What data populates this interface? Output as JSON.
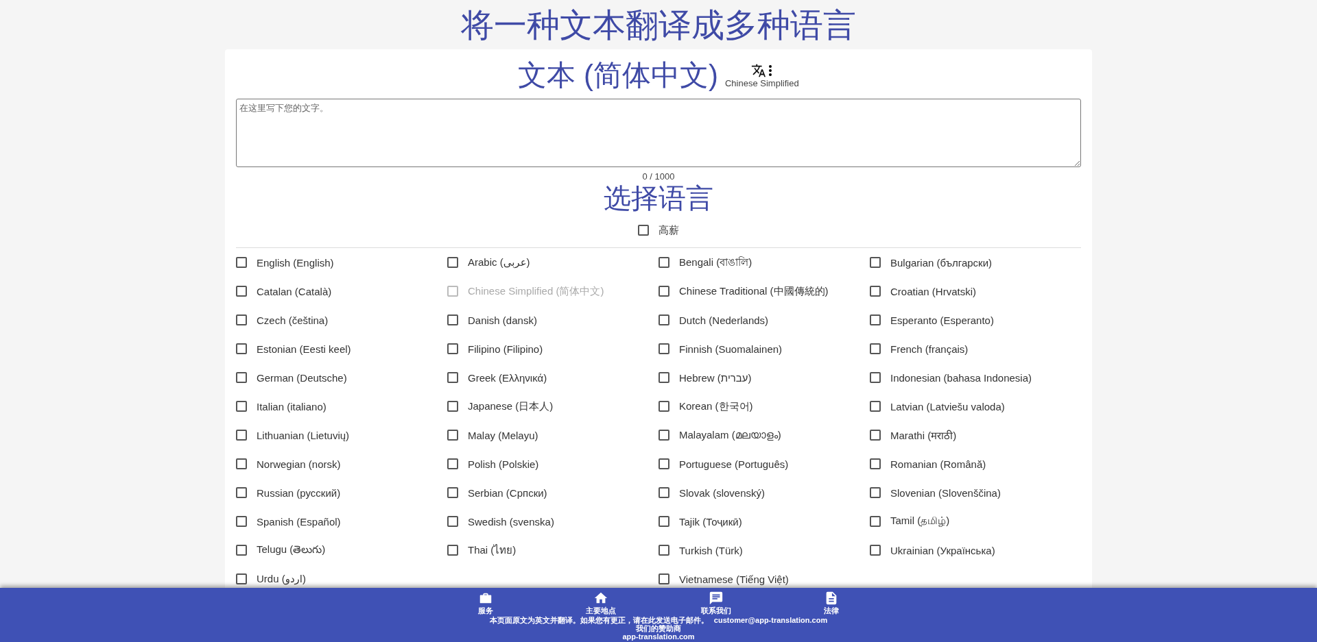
{
  "page_title": "将一种文本翻译成多种语言",
  "source": {
    "title": "文本 (简体中文)",
    "language_label": "Chinese Simplified",
    "placeholder": "在这里写下您的文字。",
    "counter": "0 / 1000"
  },
  "target": {
    "title": "选择语言",
    "select_all": {
      "label": "高薪",
      "checked": false
    },
    "languages": [
      {
        "label": "English (English)",
        "checked": false,
        "disabled": false
      },
      {
        "label": "Arabic (عربى)",
        "checked": false,
        "disabled": false
      },
      {
        "label": "Bengali (বাঙালি)",
        "checked": false,
        "disabled": false
      },
      {
        "label": "Bulgarian (български)",
        "checked": false,
        "disabled": false
      },
      {
        "label": "Catalan (Català)",
        "checked": false,
        "disabled": false
      },
      {
        "label": "Chinese Simplified (简体中文)",
        "checked": false,
        "disabled": true
      },
      {
        "label": "Chinese Traditional (中國傳統的)",
        "checked": false,
        "disabled": false
      },
      {
        "label": "Croatian (Hrvatski)",
        "checked": false,
        "disabled": false
      },
      {
        "label": "Czech (čeština)",
        "checked": false,
        "disabled": false
      },
      {
        "label": "Danish (dansk)",
        "checked": false,
        "disabled": false
      },
      {
        "label": "Dutch (Nederlands)",
        "checked": false,
        "disabled": false
      },
      {
        "label": "Esperanto (Esperanto)",
        "checked": false,
        "disabled": false
      },
      {
        "label": "Estonian (Eesti keel)",
        "checked": false,
        "disabled": false
      },
      {
        "label": "Filipino (Filipino)",
        "checked": false,
        "disabled": false
      },
      {
        "label": "Finnish (Suomalainen)",
        "checked": false,
        "disabled": false
      },
      {
        "label": "French (français)",
        "checked": false,
        "disabled": false
      },
      {
        "label": "German (Deutsche)",
        "checked": false,
        "disabled": false
      },
      {
        "label": "Greek (Ελληνικά)",
        "checked": false,
        "disabled": false
      },
      {
        "label": "Hebrew (עברית)",
        "checked": false,
        "disabled": false
      },
      {
        "label": "Indonesian (bahasa Indonesia)",
        "checked": false,
        "disabled": false
      },
      {
        "label": "Italian (italiano)",
        "checked": false,
        "disabled": false
      },
      {
        "label": "Japanese (日本人)",
        "checked": false,
        "disabled": false
      },
      {
        "label": "Korean (한국어)",
        "checked": false,
        "disabled": false
      },
      {
        "label": "Latvian (Latviešu valoda)",
        "checked": false,
        "disabled": false
      },
      {
        "label": "Lithuanian (Lietuvių)",
        "checked": false,
        "disabled": false
      },
      {
        "label": "Malay (Melayu)",
        "checked": false,
        "disabled": false
      },
      {
        "label": "Malayalam (മലയാളം)",
        "checked": false,
        "disabled": false
      },
      {
        "label": "Marathi (मराठी)",
        "checked": false,
        "disabled": false
      },
      {
        "label": "Norwegian (norsk)",
        "checked": false,
        "disabled": false
      },
      {
        "label": "Polish (Polskie)",
        "checked": false,
        "disabled": false
      },
      {
        "label": "Portuguese (Português)",
        "checked": false,
        "disabled": false
      },
      {
        "label": "Romanian (Română)",
        "checked": false,
        "disabled": false
      },
      {
        "label": "Russian (русский)",
        "checked": false,
        "disabled": false
      },
      {
        "label": "Serbian (Српски)",
        "checked": false,
        "disabled": false
      },
      {
        "label": "Slovak (slovenský)",
        "checked": false,
        "disabled": false
      },
      {
        "label": "Slovenian (Slovenščina)",
        "checked": false,
        "disabled": false
      },
      {
        "label": "Spanish (Español)",
        "checked": false,
        "disabled": false
      },
      {
        "label": "Swedish (svenska)",
        "checked": false,
        "disabled": false
      },
      {
        "label": "Tajik (Тоҷикӣ)",
        "checked": false,
        "disabled": false
      },
      {
        "label": "Tamil (தமிழ்)",
        "checked": false,
        "disabled": false
      },
      {
        "label": "Telugu (తెలుగు)",
        "checked": false,
        "disabled": false
      },
      {
        "label": "Thai (ไทย)",
        "checked": false,
        "disabled": false
      },
      {
        "label": "Turkish (Türk)",
        "checked": false,
        "disabled": false
      },
      {
        "label": "Ukrainian (Українська)",
        "checked": false,
        "disabled": false
      },
      {
        "label": "Urdu (اردو)",
        "checked": false,
        "disabled": false
      },
      {
        "label": "Vietnamese (Tiếng Việt)",
        "checked": false,
        "disabled": false
      }
    ]
  },
  "footer": {
    "links": [
      {
        "label": "服务",
        "kind": "briefcase"
      },
      {
        "label": "主要地点",
        "kind": "home"
      },
      {
        "label": "联系我们",
        "kind": "chat"
      },
      {
        "label": "法律",
        "kind": "document"
      }
    ],
    "notice": "本页面原文为英文并翻译。如果您有更正，请在此发送电子邮件。",
    "email": "customer@app-translation.com",
    "sponsors_title": "我们的赞助商",
    "sponsor": "app-translation.com"
  }
}
